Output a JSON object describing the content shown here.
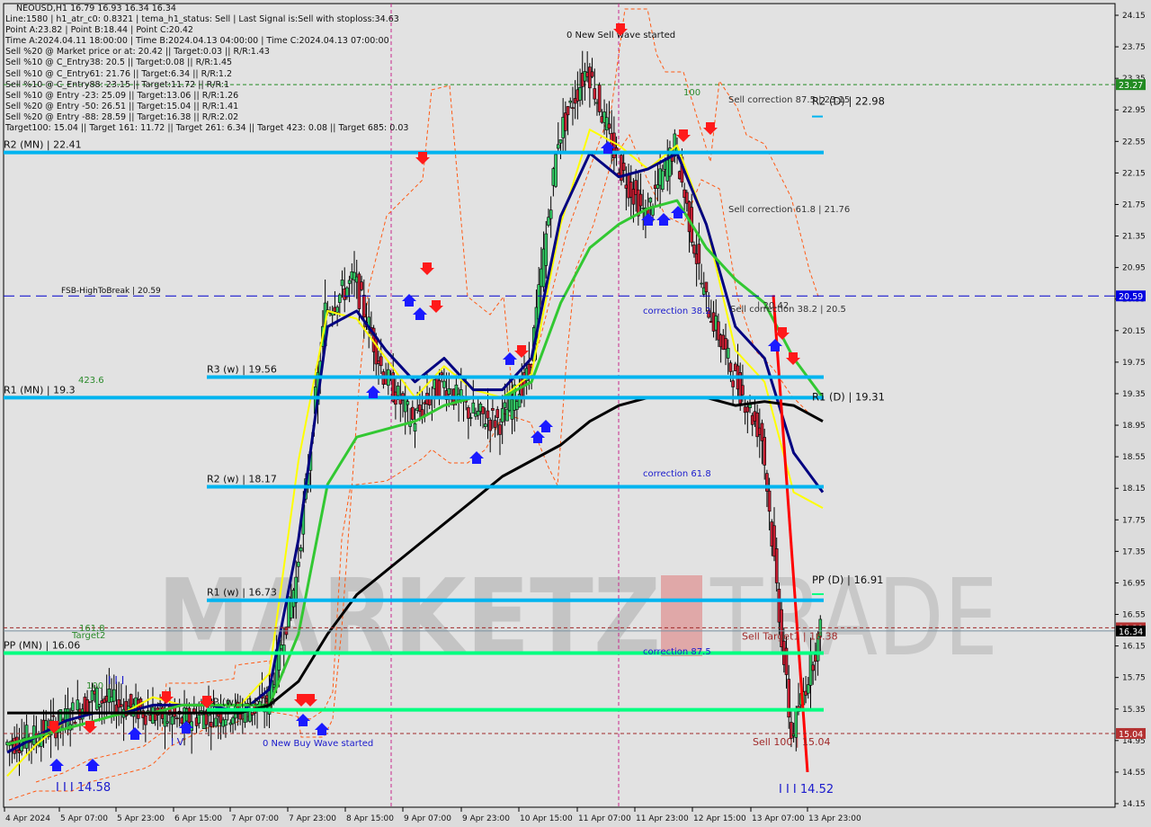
{
  "window": {
    "symbol_line": "NEOUSD,H1  16.79 16.93 16.34 16.34"
  },
  "info_lines": [
    "Line:1580 | h1_atr_c0: 0.8321 | tema_h1_status: Sell | Last Signal is:Sell with stoploss:34.63",
    "Point A:23.82 | Point B:18.44 | Point C:20.42",
    "Time A:2024.04.11 18:00:00 | Time B:2024.04.13 04:00:00 | Time C:2024.04.13 07:00:00",
    "Sell %20 @ Market price or at: 20.42 || Target:0.03 || R/R:1.43",
    "Sell %10 @ C_Entry38: 20.5 || Target:0.08 || R/R:1.45",
    "Sell %10 @ C_Entry61: 21.76 || Target:6.34 || R/R:1.2",
    "Sell %10 @ C_Entry88: 23.15 || Target:11.72 || R/R:1",
    "Sell %10 @ Entry -23: 25.09 || Target:13.06 || R/R:1.26",
    "Sell %20 @ Entry -50: 26.51 || Target:15.04 || R/R:1.41",
    "Sell %20 @ Entry -88: 28.59 || Target:16.38 || R/R:2.02",
    "Target100: 15.04 || Target 161: 11.72 || Target 261: 6.34 || Target 423: 0.08 || Target 685: 0.03"
  ],
  "watermark": {
    "left": "MARKETZ",
    "right": "TRADE"
  },
  "colors": {
    "background": "#dcdcdc",
    "pivot_resistance": "#00b4f0",
    "pivot_pp": "#00ff80",
    "ema_fast": "#ffff00",
    "ema_mid": "#000080",
    "ema_slow": "#32c832",
    "ema_long": "#000000",
    "bull_candle": "#32c864",
    "bear_candle": "#c81e32",
    "sell_arrow": "#ff1a1a",
    "buy_arrow": "#1a1aff",
    "channel": "#ff5a14",
    "fsb_line": "#0000cc",
    "target_line": "#a02828",
    "price_green_tag": "#228b22",
    "price_blue_tag": "#0000e0",
    "price_red_tag": "#b43232",
    "current_price_tag": "#000000"
  },
  "chart_data": {
    "type": "candlestick",
    "title": "NEOUSD,H1",
    "ohlc_last": {
      "open": 16.79,
      "high": 16.93,
      "low": 16.34,
      "close": 16.34
    },
    "ylim": [
      14.05,
      24.3
    ],
    "y_ticks": [
      "24.15",
      "23.75",
      "23.35",
      "22.95",
      "22.55",
      "22.15",
      "21.75",
      "21.35",
      "20.95",
      "20.55",
      "20.15",
      "19.75",
      "19.35",
      "18.95",
      "18.55",
      "18.15",
      "17.75",
      "17.35",
      "16.95",
      "16.55",
      "16.15",
      "15.75",
      "15.35",
      "14.95",
      "14.55",
      "14.15"
    ],
    "x_ticks": [
      "4 Apr 2024",
      "5 Apr 07:00",
      "5 Apr 23:00",
      "6 Apr 15:00",
      "7 Apr 07:00",
      "7 Apr 23:00",
      "8 Apr 15:00",
      "9 Apr 07:00",
      "9 Apr 23:00",
      "10 Apr 15:00",
      "11 Apr 07:00",
      "11 Apr 23:00",
      "12 Apr 15:00",
      "13 Apr 07:00",
      "13 Apr 23:00"
    ],
    "price_tags": [
      {
        "value": "23.27",
        "kind": "green"
      },
      {
        "value": "20.59",
        "kind": "blue"
      },
      {
        "value": "16.38",
        "kind": "red"
      },
      {
        "value": "16.34",
        "kind": "current"
      },
      {
        "value": "15.04",
        "kind": "red"
      }
    ],
    "levels": [
      {
        "label": "R2 (MN) | 22.41",
        "value": 22.41,
        "kind": "resistance",
        "span": "full"
      },
      {
        "label": "R1 (MN) | 19.3",
        "value": 19.3,
        "kind": "resistance",
        "span": "full"
      },
      {
        "label": "PP (MN) | 16.06",
        "value": 16.06,
        "kind": "pp",
        "span": "full"
      },
      {
        "label": "R3 (w) | 19.56",
        "value": 19.56,
        "kind": "resistance",
        "span": "weekly"
      },
      {
        "label": "R2 (w) | 18.17",
        "value": 18.17,
        "kind": "resistance",
        "span": "weekly"
      },
      {
        "label": "R1 (w) | 16.73",
        "value": 16.73,
        "kind": "resistance",
        "span": "weekly"
      },
      {
        "label": "PP (w) | 15.34",
        "value": 15.34,
        "kind": "pp",
        "span": "weekly"
      },
      {
        "label": "R2 (D) | 22.98",
        "value": 22.98,
        "kind": "daily"
      },
      {
        "label": "R1 (D) | 19.31",
        "value": 19.31,
        "kind": "daily"
      },
      {
        "label": "PP (D) | 16.91",
        "value": 16.91,
        "kind": "daily"
      }
    ],
    "fsb_line": {
      "label": "FSB-HighToBreak | 20.59",
      "value": 20.59
    },
    "target_lines": [
      {
        "label": "Sell Target1 | 16.38",
        "value": 16.38
      },
      {
        "label": "Sell 100 | 15.04",
        "value": 15.04
      }
    ],
    "green_dashed_level": 23.27,
    "annotations": [
      {
        "text": "0 New Sell wave started",
        "x": "11 Apr 07:00",
        "y": 23.85
      },
      {
        "text": "0 New Buy Wave started",
        "x": "7 Apr 23:00",
        "y": 14.95
      },
      {
        "text": "Sell correction 87.5 | 23.15",
        "y": 22.98
      },
      {
        "text": "Sell correction 61.8 | 21.76",
        "y": 21.76
      },
      {
        "text": "Sell correction 38.2 | 20.5",
        "y": 20.5
      },
      {
        "text": "correction 38.2",
        "y": 20.5
      },
      {
        "text": "correction 61.8",
        "y": 18.25
      },
      {
        "text": "correction 87.5",
        "y": 16.08
      },
      {
        "text": "423.6",
        "y": 19.4
      },
      {
        "text": "161.8",
        "y": 16.4
      },
      {
        "text": "Target2",
        "y": 16.3
      },
      {
        "text": "100",
        "y": 15.6
      },
      {
        "text": "100",
        "y": 22.95
      },
      {
        "text": "I I I 14.58",
        "y": 14.58
      },
      {
        "text": "I I I 14.52",
        "y": 14.52
      },
      {
        "text": "I I I",
        "y": 15.8
      },
      {
        "text": "I V",
        "y": 14.95
      },
      {
        "text": "| 20.42",
        "y": 20.42
      }
    ],
    "series": [
      {
        "name": "EMA fast (yellow)",
        "values_approx": [
          14.5,
          14.9,
          15.2,
          15.3,
          15.3,
          15.5,
          15.4,
          15.4,
          15.4,
          15.8,
          18.5,
          20.4,
          20.3,
          19.8,
          19.3,
          19.7,
          19.4,
          19.3,
          19.6,
          21.5,
          22.7,
          22.5,
          22.2,
          22.5,
          21.5,
          19.9,
          19.5,
          18.1,
          17.9
        ]
      },
      {
        "name": "EMA mid (navy)",
        "values_approx": [
          14.8,
          15.0,
          15.2,
          15.3,
          15.3,
          15.4,
          15.4,
          15.4,
          15.3,
          15.6,
          17.5,
          20.2,
          20.4,
          19.9,
          19.5,
          19.8,
          19.4,
          19.4,
          19.8,
          21.6,
          22.4,
          22.1,
          22.2,
          22.4,
          21.5,
          20.2,
          19.8,
          18.6,
          18.1
        ]
      },
      {
        "name": "EMA slow (green)",
        "values_approx": [
          14.9,
          15.0,
          15.1,
          15.2,
          15.3,
          15.3,
          15.4,
          15.4,
          15.4,
          15.4,
          16.3,
          18.2,
          18.8,
          18.9,
          19.0,
          19.2,
          19.3,
          19.3,
          19.5,
          20.5,
          21.2,
          21.5,
          21.7,
          21.8,
          21.2,
          20.8,
          20.5,
          19.8,
          19.3
        ]
      },
      {
        "name": "SMA long (black)",
        "values_approx": [
          15.3,
          15.3,
          15.3,
          15.3,
          15.3,
          15.3,
          15.3,
          15.3,
          15.3,
          15.4,
          15.7,
          16.3,
          16.8,
          17.1,
          17.4,
          17.7,
          18.0,
          18.3,
          18.5,
          18.7,
          19.0,
          19.2,
          19.3,
          19.3,
          19.3,
          19.2,
          19.25,
          19.2,
          19.0
        ]
      }
    ],
    "candles_close_approx": [
      14.9,
      15.0,
      15.2,
      15.5,
      15.4,
      15.3,
      15.2,
      15.3,
      15.3,
      15.4,
      17.0,
      20.4,
      20.8,
      19.6,
      19.0,
      19.5,
      19.1,
      19.0,
      19.6,
      22.6,
      23.5,
      22.3,
      21.6,
      22.5,
      20.6,
      19.6,
      18.8,
      15.0,
      16.34
    ]
  }
}
